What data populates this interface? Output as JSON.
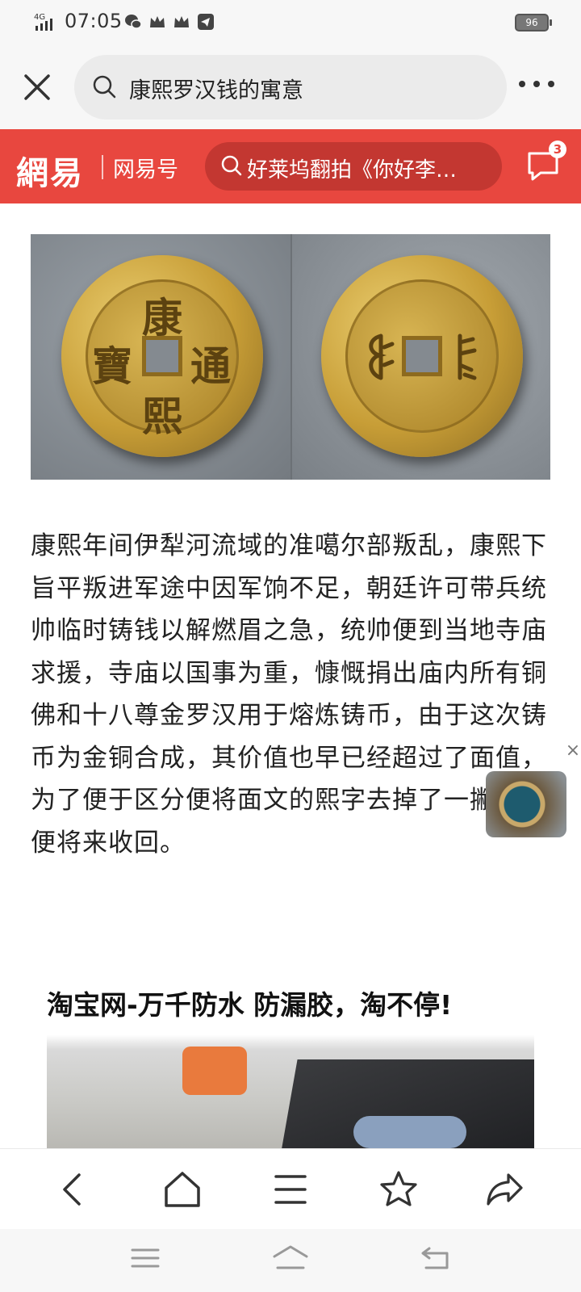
{
  "status_bar": {
    "network": "4G",
    "time": "07:05",
    "battery": "96",
    "icons": [
      "wechat-icon",
      "crown-icon",
      "crown-icon",
      "telegram-icon"
    ]
  },
  "browser": {
    "search_query": "康熙罗汉钱的寓意"
  },
  "netease": {
    "logo": "網易",
    "channel": "网易号",
    "search_hint": "好莱坞翻拍《你好李…",
    "message_count": "3"
  },
  "coins": {
    "obverse_chars": [
      "康",
      "熙",
      "寶",
      "通"
    ]
  },
  "article": {
    "text": "康熙年间伊犁河流域的准噶尔部叛乱，康熙下旨平叛进军途中因军饷不足，朝廷许可带兵统帅临时铸钱以解燃眉之急，统帅便到当地寺庙求援，寺庙以国事为重，慷慨捐出庙内所有铜佛和十八尊金罗汉用于熔炼铸币，由于这次铸币为金铜合成，其价值也早已经超过了面值，为了便于区分便将面文的熙字去掉了一撇，以便将来收回。"
  },
  "ad": {
    "title": "淘宝网-万千防水 防漏胶，淘不停!"
  }
}
